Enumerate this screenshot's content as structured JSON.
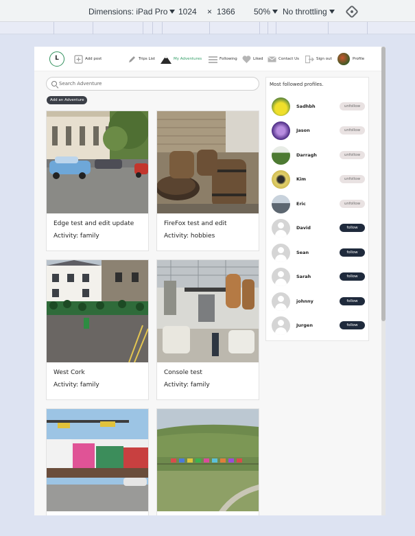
{
  "devtools": {
    "dimensions_label": "Dimensions: iPad Pro",
    "width": "1024",
    "times": "×",
    "height": "1366",
    "zoom": "50%",
    "throttling": "No throttling"
  },
  "nav": {
    "logo_text": "L",
    "items": [
      {
        "label": "Add post",
        "icon": "plus-square-icon"
      },
      {
        "label": "Trips List",
        "icon": "pencil-icon"
      },
      {
        "label": "My Adventures",
        "icon": "mountain-icon",
        "active": true
      },
      {
        "label": "Following",
        "icon": "stream-icon"
      },
      {
        "label": "Liked",
        "icon": "heart-icon"
      },
      {
        "label": "Contact Us",
        "icon": "envelope-icon"
      },
      {
        "label": "Sign out",
        "icon": "sign-out-icon"
      },
      {
        "label": "Profile",
        "icon": "avatar-icon"
      }
    ],
    "active_color": "#2f9c64"
  },
  "search": {
    "placeholder": "Search Adventure"
  },
  "add_adventure_label": "Add an Adventure",
  "cards": [
    {
      "title": "Edge test and edit update",
      "activity": "Activity: family"
    },
    {
      "title": "FireFox test and edit",
      "activity": "Activity: hobbies"
    },
    {
      "title": "West Cork",
      "activity": "Activity: family"
    },
    {
      "title": "Console test",
      "activity": "Activity: family"
    },
    {
      "title": "",
      "activity": ""
    },
    {
      "title": "",
      "activity": ""
    }
  ],
  "profiles": {
    "title": "Most followed profiles.",
    "items": [
      {
        "name": "Sadhbh",
        "button": "unfollow"
      },
      {
        "name": "Jason",
        "button": "unfollow"
      },
      {
        "name": "Darragh",
        "button": "unfollow"
      },
      {
        "name": "Kim",
        "button": "unfollow"
      },
      {
        "name": "Eric",
        "button": "unfollow"
      },
      {
        "name": "David",
        "button": "follow"
      },
      {
        "name": "Sean",
        "button": "follow"
      },
      {
        "name": "Sarah",
        "button": "follow"
      },
      {
        "name": "johnny",
        "button": "follow"
      },
      {
        "name": "Jurgen",
        "button": "follow"
      }
    ]
  }
}
